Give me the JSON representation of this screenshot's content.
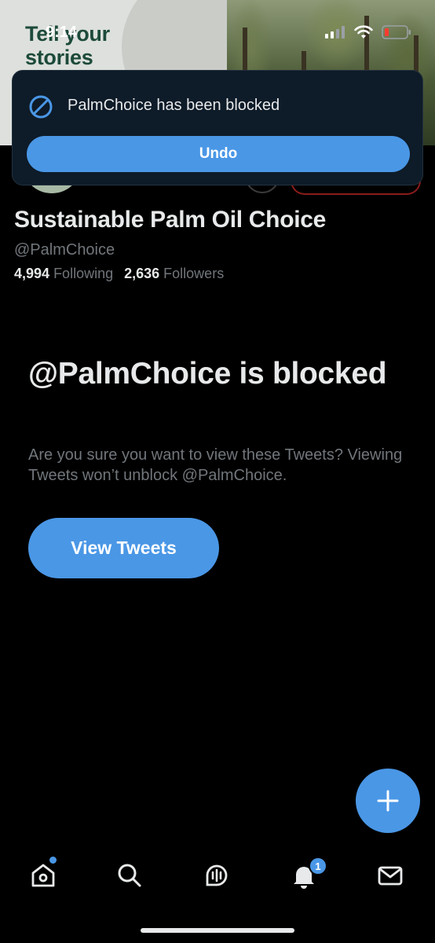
{
  "status_bar": {
    "time": "9:14"
  },
  "banner": {
    "title_line1": "Tell your",
    "title_line2": "stories"
  },
  "toast": {
    "message": "PalmChoice has been blocked",
    "undo_label": "Undo"
  },
  "profile": {
    "display_name": "Sustainable Palm Oil Choice",
    "handle": "@PalmChoice",
    "following_count": "4,994",
    "following_label": "Following",
    "followers_count": "2,636",
    "followers_label": "Followers"
  },
  "blocked_notice": {
    "title": "@PalmChoice is blocked",
    "description": "Are you sure you want to view these Tweets? Viewing Tweets won’t unblock @PalmChoice.",
    "view_button_label": "View Tweets"
  },
  "tabbar": {
    "items": [
      {
        "name": "home",
        "icon": "home-icon"
      },
      {
        "name": "search",
        "icon": "search-icon"
      },
      {
        "name": "spaces",
        "icon": "spaces-icon"
      },
      {
        "name": "notifications",
        "icon": "bell-icon",
        "badge": "1"
      },
      {
        "name": "messages",
        "icon": "mail-icon"
      }
    ]
  },
  "colors": {
    "accent": "#4a97e6",
    "background": "#000000",
    "muted": "#71767b",
    "toast_bg": "#0e1b28"
  }
}
